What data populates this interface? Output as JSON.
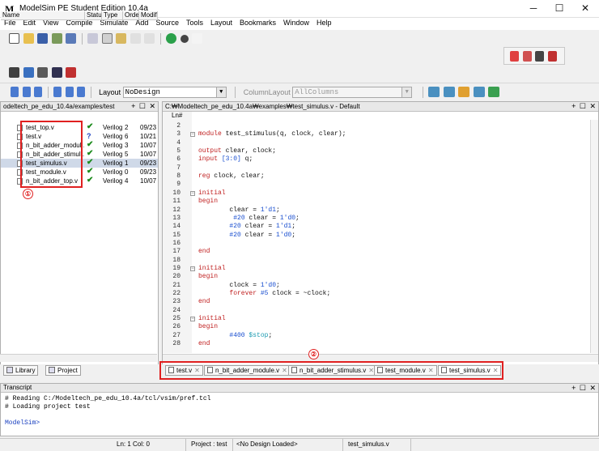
{
  "window": {
    "title": "ModelSim PE Student Edition 10.4a",
    "logo": "M",
    "controls": [
      "─",
      "☐",
      "✕"
    ]
  },
  "menu": [
    "File",
    "Edit",
    "View",
    "Compile",
    "Simulate",
    "Add",
    "Source",
    "Tools",
    "Layout",
    "Bookmarks",
    "Window",
    "Help"
  ],
  "toolbar": {
    "layout_label": "Layout",
    "layout_value": "NoDesign",
    "column_layout_label": "ColumnLayout",
    "column_layout_value": "AllColumns"
  },
  "project_panel": {
    "title": "odeltech_pe_edu_10.4a/examples/test",
    "header_buttons": "+ ☐ ✕",
    "columns": [
      "Name",
      "Status",
      "Type",
      "Order",
      "Modifi"
    ],
    "files": [
      {
        "name": "test_top.v",
        "status": "✔",
        "type": "Verilog",
        "order": "2",
        "modified": "09/23"
      },
      {
        "name": "test.v",
        "status": "?",
        "type": "Verilog",
        "order": "6",
        "modified": "10/21"
      },
      {
        "name": "n_bit_adder_modul...",
        "status": "✔",
        "type": "Verilog",
        "order": "3",
        "modified": "10/07"
      },
      {
        "name": "n_bit_adder_stimul...",
        "status": "✔",
        "type": "Verilog",
        "order": "5",
        "modified": "10/07"
      },
      {
        "name": "test_simulus.v",
        "status": "✔",
        "type": "Verilog",
        "order": "1",
        "modified": "09/23"
      },
      {
        "name": "test_module.v",
        "status": "✔",
        "type": "Verilog",
        "order": "0",
        "modified": "09/23"
      },
      {
        "name": "n_bit_adder_top.v",
        "status": "✔",
        "type": "Verilog",
        "order": "4",
        "modified": "10/07"
      }
    ],
    "annotation": "①",
    "tabs": [
      "Library",
      "Project"
    ]
  },
  "editor": {
    "title": "C:₩Modeltech_pe_edu_10.4a₩examples₩test_simulus.v - Default",
    "header_buttons": "+ ☐ ✕",
    "ln_header": "Ln#",
    "line_numbers": [
      "2",
      "3",
      "4",
      "5",
      "6",
      "7",
      "8",
      "9",
      "10",
      "11",
      "12",
      "13",
      "14",
      "15",
      "16",
      "17",
      "18",
      "19",
      "20",
      "21",
      "22",
      "23",
      "24",
      "25",
      "26",
      "27",
      "28"
    ],
    "lines": [
      {
        "code": ""
      },
      {
        "code": "module test_stimulus(q, clock, clear);",
        "fold": true
      },
      {
        "code": ""
      },
      {
        "code": "output clear, clock;"
      },
      {
        "code": "input [3:0] q;"
      },
      {
        "code": ""
      },
      {
        "code": "reg clock, clear;"
      },
      {
        "code": ""
      },
      {
        "code": "initial",
        "fold": true
      },
      {
        "code": "begin"
      },
      {
        "code": "        clear = 1'd1;"
      },
      {
        "code": "         #20 clear = 1'd0;"
      },
      {
        "code": "        #20 clear = 1'd1;"
      },
      {
        "code": "        #20 clear = 1'd0;"
      },
      {
        "code": ""
      },
      {
        "code": "end"
      },
      {
        "code": ""
      },
      {
        "code": "initial",
        "fold": true
      },
      {
        "code": "begin"
      },
      {
        "code": "        clock = 1'd0;"
      },
      {
        "code": "        forever #5 clock = ~clock;"
      },
      {
        "code": "end"
      },
      {
        "code": ""
      },
      {
        "code": "initial",
        "fold": true
      },
      {
        "code": "begin"
      },
      {
        "code": "        #400 $stop;"
      },
      {
        "code": "end"
      }
    ],
    "tabs": [
      "test.v",
      "n_bit_adder_module.v",
      "n_bit_adder_stimulus.v",
      "test_module.v",
      "test_simulus.v"
    ],
    "active_tab": "test_simulus.v",
    "annotation": "②"
  },
  "transcript": {
    "title": "Transcript",
    "header_buttons": "+ ☐ ✕",
    "lines": [
      "# Reading C:/Modeltech_pe_edu_10.4a/tcl/vsim/pref.tcl",
      "# Loading project test"
    ],
    "prompt": "ModelSim>"
  },
  "statusbar": {
    "position": "Ln:   1  Col: 0",
    "project": "Project : test",
    "design": "<No Design Loaded>",
    "file": "test_simulus.v"
  },
  "colors": {
    "keyword": "#c02020",
    "number": "#1a4fd0",
    "system_task": "#1a9ab0",
    "annotation": "#e02020",
    "status_ok": "#1a8a1a"
  }
}
